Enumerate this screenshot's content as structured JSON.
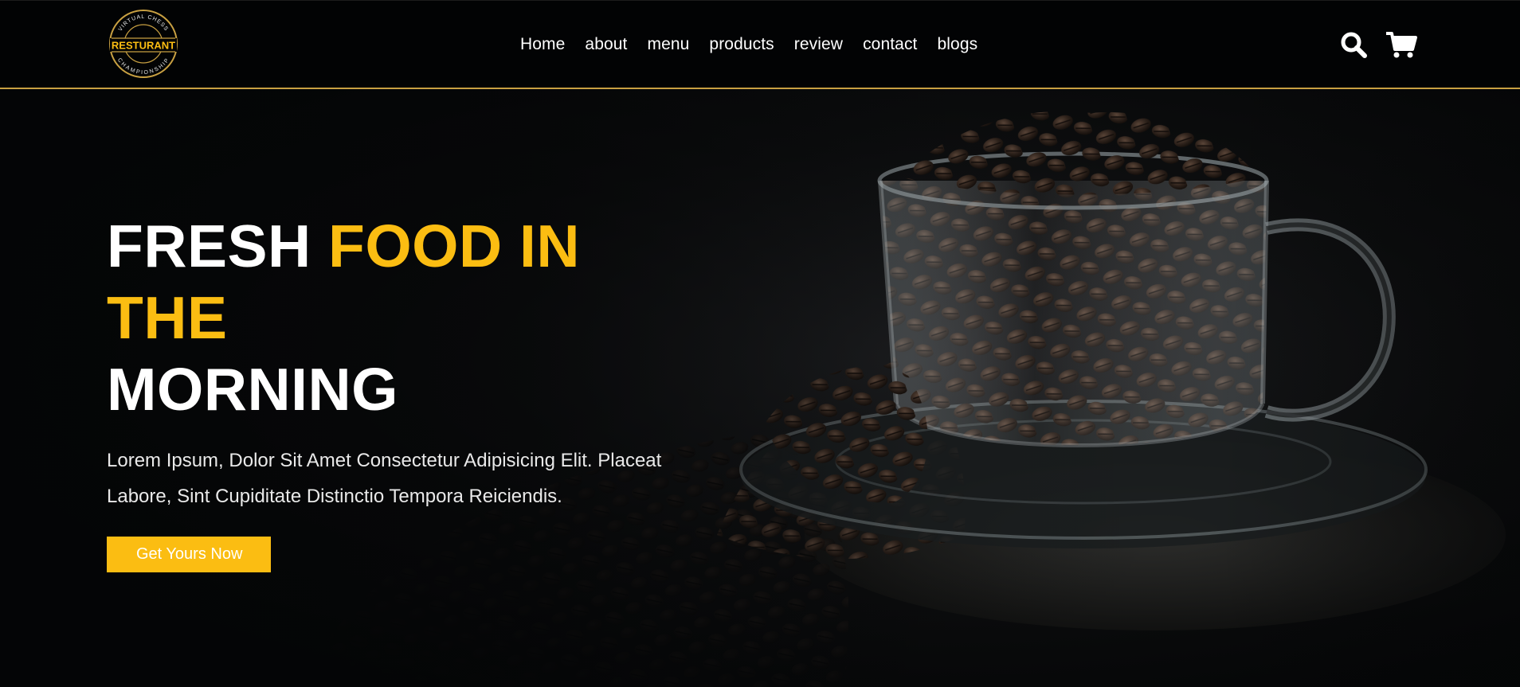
{
  "brand": {
    "logo_text": "RESTURANT",
    "logo_ring_text_top": "VIRTUAL CHESS",
    "logo_ring_text_bottom": "CHAMPIONSHIP",
    "accent_color": "#fbbd12"
  },
  "nav": {
    "items": [
      {
        "label": "Home"
      },
      {
        "label": "about"
      },
      {
        "label": "menu"
      },
      {
        "label": "products"
      },
      {
        "label": "review"
      },
      {
        "label": "contact"
      },
      {
        "label": "blogs"
      }
    ]
  },
  "header_icons": {
    "search": "search-icon",
    "cart": "cart-icon"
  },
  "hero": {
    "title_part1": "FRESH ",
    "title_accent": "FOOD IN THE",
    "title_part2": "MORNING",
    "text": "Lorem Ipsum, Dolor Sit Amet Consectetur Adipisicing Elit. Placeat Labore, Sint Cupiditate Distinctio Tempora Reiciendis.",
    "cta_label": "Get Yours Now",
    "background": "coffee beans in glass cup on saucer"
  }
}
